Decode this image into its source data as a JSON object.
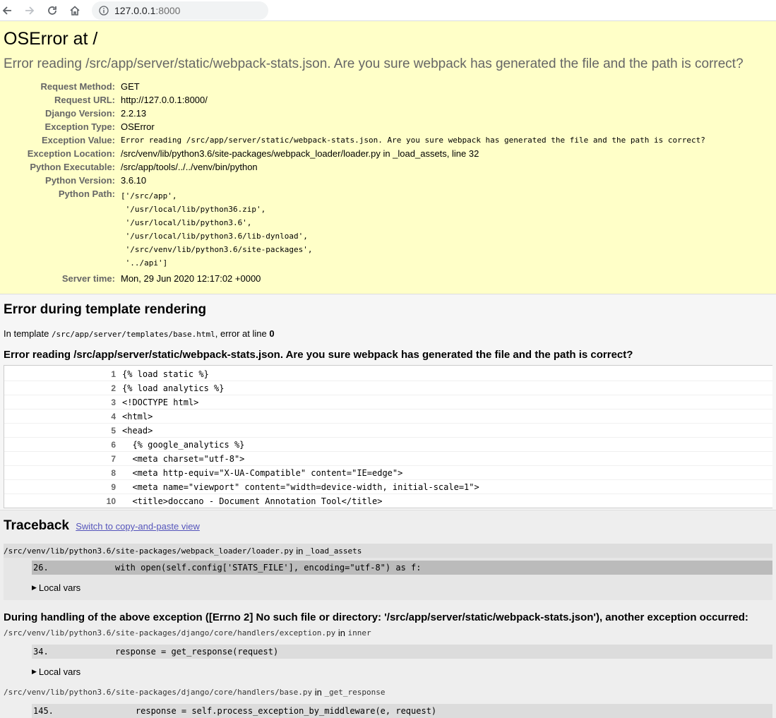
{
  "browser": {
    "url_host": "127.0.0.1",
    "url_port": ":8000"
  },
  "summary": {
    "title": "OSError at /",
    "message": "Error reading /src/app/server/static/webpack-stats.json. Are you sure webpack has generated the file and the path is correct?",
    "meta": [
      {
        "label": "Request Method:",
        "value": "GET",
        "mono": false
      },
      {
        "label": "Request URL:",
        "value": "http://127.0.0.1:8000/",
        "mono": false
      },
      {
        "label": "Django Version:",
        "value": "2.2.13",
        "mono": false
      },
      {
        "label": "Exception Type:",
        "value": "OSError",
        "mono": false
      },
      {
        "label": "Exception Value:",
        "value": "Error reading /src/app/server/static/webpack-stats.json. Are you sure webpack has generated the file and the path is correct?",
        "mono": true
      },
      {
        "label": "Exception Location:",
        "value": "/src/venv/lib/python3.6/site-packages/webpack_loader/loader.py in _load_assets, line 32",
        "mono": false
      },
      {
        "label": "Python Executable:",
        "value": "/src/app/tools/../../venv/bin/python",
        "mono": false
      },
      {
        "label": "Python Version:",
        "value": "3.6.10",
        "mono": false
      }
    ],
    "python_path_label": "Python Path:",
    "python_path": [
      "['/src/app',",
      " '/usr/local/lib/python36.zip',",
      " '/usr/local/lib/python3.6',",
      " '/usr/local/lib/python3.6/lib-dynload',",
      " '/src/venv/lib/python3.6/site-packages',",
      " '../api']"
    ],
    "server_time_label": "Server time:",
    "server_time": "Mon, 29 Jun 2020 12:17:02 +0000"
  },
  "template": {
    "heading": "Error during template rendering",
    "intro_prefix": "In template ",
    "template_path": "/src/app/server/templates/base.html",
    "intro_mid": ", error at line ",
    "error_line": "0",
    "error_message": "Error reading /src/app/server/static/webpack-stats.json. Are you sure webpack has generated the file and the path is correct?",
    "lines": [
      {
        "num": "1",
        "code": "{% load static %}"
      },
      {
        "num": "2",
        "code": "{% load analytics %}"
      },
      {
        "num": "3",
        "code": "<!DOCTYPE html>"
      },
      {
        "num": "4",
        "code": "<html>"
      },
      {
        "num": "5",
        "code": "<head>"
      },
      {
        "num": "6",
        "code": "  {% google_analytics %}"
      },
      {
        "num": "7",
        "code": "  <meta charset=\"utf-8\">"
      },
      {
        "num": "8",
        "code": "  <meta http-equiv=\"X-UA-Compatible\" content=\"IE=edge\">"
      },
      {
        "num": "9",
        "code": "  <meta name=\"viewport\" content=\"width=device-width, initial-scale=1\">"
      },
      {
        "num": "10",
        "code": "  <title>doccano - Document Annotation Tool</title>"
      }
    ]
  },
  "traceback": {
    "heading": "Traceback",
    "switch_link": "Switch to copy-and-paste view",
    "local_vars": "Local vars",
    "handling_message": "During handling of the above exception ([Errno 2] No such file or directory: '/src/app/server/static/webpack-stats.json'), another exception occurred:",
    "frames": [
      {
        "file": "/src/venv/lib/python3.6/site-packages/webpack_loader/loader.py",
        "in": " in ",
        "func": "_load_assets",
        "num": "26.",
        "code": "with open(self.config['STATS_FILE'], encoding=\"utf-8\") as f:"
      },
      {
        "file": "/src/venv/lib/python3.6/site-packages/django/core/handlers/exception.py",
        "in": " in ",
        "func": "inner",
        "num": "34.",
        "code": "response = get_response(request)"
      },
      {
        "file": "/src/venv/lib/python3.6/site-packages/django/core/handlers/base.py",
        "in": " in ",
        "func": "_get_response",
        "num": "145.",
        "code": "    response = self.process_exception_by_middleware(e, request)"
      }
    ]
  }
}
